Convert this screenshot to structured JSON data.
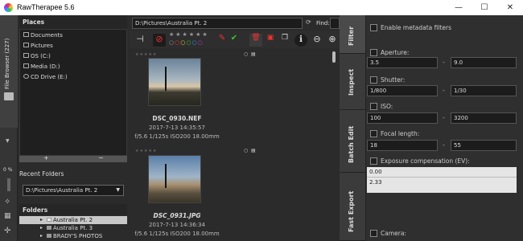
{
  "window": {
    "title": "RawTherapee 5.6",
    "minimize": "—",
    "maximize": "☐",
    "close": "✕"
  },
  "left_panel": {
    "tab": "File Browser (227)",
    "zoom": "0 %"
  },
  "places": {
    "header": "Places",
    "items": [
      "Documents",
      "Pictures",
      "OS (C:)",
      "Media (D:)",
      "CD Drive (E:)"
    ],
    "add": "+",
    "remove": "−"
  },
  "recent": {
    "header": "Recent Folders",
    "selected": "D:\\Pictures\\Australia Pt. 2"
  },
  "folders": {
    "header": "Folders",
    "items": [
      "Australia Pt. 2",
      "Australia Pt. 3",
      "BRADY'S PHOTOS"
    ]
  },
  "center": {
    "path": "D:\\Pictures\\Australia Pt. 2",
    "find_label": "Find:"
  },
  "thumbs": [
    {
      "name": "DSC_0930.NEF",
      "date": "2017-7-13 14:35:57",
      "info": "f/5.6 1/125s ISO200 18.00mm",
      "stars": "★★★★★"
    },
    {
      "name": "DSC_0931.JPG",
      "date": "2017-7-13 14:36:34",
      "info": "f/5.6 1/125s ISO200 18.00mm",
      "stars": "★★★★★"
    }
  ],
  "right_tabs": [
    "Filter",
    "Inspect",
    "Batch Edit",
    "Fast Export"
  ],
  "filter": {
    "metadata": "Enable metadata filters",
    "aperture": {
      "label": "Aperture:",
      "min": "3.5",
      "max": "9.0"
    },
    "shutter": {
      "label": "Shutter:",
      "min": "1/800",
      "max": "1/30"
    },
    "iso": {
      "label": "ISO:",
      "min": "100",
      "max": "3200"
    },
    "focal": {
      "label": "Focal length:",
      "min": "18",
      "max": "55"
    },
    "ev": {
      "label": "Exposure compensation (EV):",
      "values": [
        "0.00",
        "2.33"
      ]
    },
    "camera": {
      "label": "Camera:"
    },
    "dash": "-"
  },
  "colors": {
    "accent": "#e33",
    "dark": "#2b2b2b"
  }
}
